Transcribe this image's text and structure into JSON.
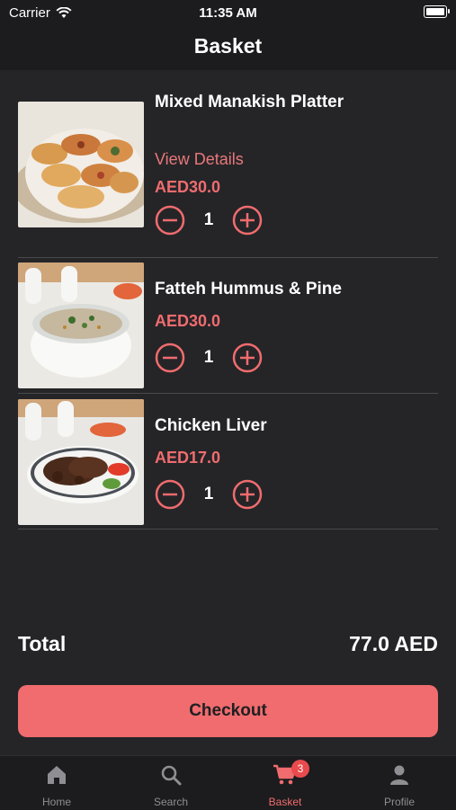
{
  "status_bar": {
    "carrier": "Carrier",
    "time": "11:35 AM"
  },
  "header": {
    "title": "Basket"
  },
  "items": [
    {
      "name": "Mixed Manakish Platter",
      "details_label": "View Details",
      "price": "AED30.0",
      "quantity": "1",
      "image_icon": "manakish-photo"
    },
    {
      "name": "Fatteh Hummus & Pine",
      "price": "AED30.0",
      "quantity": "1",
      "image_icon": "fatteh-photo"
    },
    {
      "name": "Chicken Liver",
      "price": "AED17.0",
      "quantity": "1",
      "image_icon": "chicken-liver-photo"
    }
  ],
  "summary": {
    "total_label": "Total",
    "total_value": "77.0 AED"
  },
  "checkout_label": "Checkout",
  "tabs": [
    {
      "label": "Home",
      "icon": "home-icon"
    },
    {
      "label": "Search",
      "icon": "search-icon"
    },
    {
      "label": "Basket",
      "icon": "cart-icon",
      "badge": "3",
      "active": true
    },
    {
      "label": "Profile",
      "icon": "profile-icon"
    }
  ],
  "colors": {
    "accent": "#f06c6e",
    "background": "#252528",
    "bar": "#1c1c1e",
    "inactive": "#8e8e93",
    "badge": "#e94a4d"
  }
}
